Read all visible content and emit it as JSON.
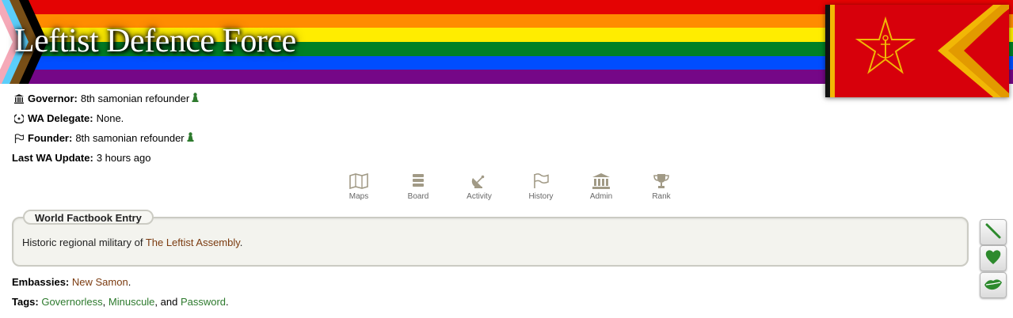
{
  "region": {
    "name": "Leftist Defence Force"
  },
  "officers": [
    {
      "icon": "government-building-icon",
      "label": "Governor:",
      "value": "8th samonian refounder",
      "has_pawn": true
    },
    {
      "icon": "wa-delegate-icon",
      "label": "WA Delegate:",
      "value": "None.",
      "has_pawn": false
    },
    {
      "icon": "flag-outline-icon",
      "label": "Founder:",
      "value": "8th samonian refounder",
      "has_pawn": true
    }
  ],
  "last_update": {
    "label": "Last WA Update:",
    "value": "3 hours ago"
  },
  "nav": [
    {
      "icon": "map-icon",
      "label": "Maps"
    },
    {
      "icon": "board-icon",
      "label": "Board"
    },
    {
      "icon": "satellite-dish-icon",
      "label": "Activity"
    },
    {
      "icon": "flag-icon",
      "label": "History"
    },
    {
      "icon": "admin-building-icon",
      "label": "Admin"
    },
    {
      "icon": "trophy-icon",
      "label": "Rank"
    }
  ],
  "factbook": {
    "title": "World Factbook Entry",
    "text_prefix": "Historic regional military of ",
    "link": "The Leftist Assembly",
    "text_suffix": "."
  },
  "embassies": {
    "label": "Embassies:",
    "items": [
      "New Samon"
    ],
    "suffix": "."
  },
  "tags": {
    "label": "Tags:",
    "items": [
      "Governorless",
      "Minusculе",
      "Password"
    ]
  },
  "side_buttons": [
    {
      "icon": "pencil-icon"
    },
    {
      "icon": "heart-icon"
    },
    {
      "icon": "lips-icon"
    }
  ],
  "colors": {
    "stripes": [
      "#e40303",
      "#ff8c00",
      "#ffed00",
      "#008026",
      "#004dff",
      "#750787"
    ],
    "region_link": "#7b3b10",
    "tag_link": "#2d7a2d",
    "nav_icon": "#a19a86",
    "flag_red": "#d7000b",
    "flag_gold": "#f2b705"
  }
}
